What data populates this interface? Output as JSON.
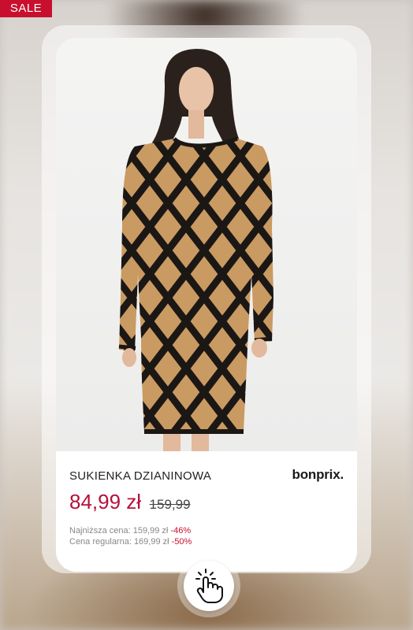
{
  "badge": {
    "label": "SALE"
  },
  "product": {
    "name": "SUKIENKA DZIANINOWA",
    "brand": "bonprix.",
    "price_current": "84,99 zł",
    "price_old": "159,99",
    "lowest_price_label": "Najniższa cena: 159,99 zł",
    "lowest_price_discount": "-46%",
    "regular_price_label": "Cena regularna: 169,99 zł",
    "regular_price_discount": "-50%",
    "image_icon": "model-in-argyle-knit-dress"
  },
  "cta": {
    "icon": "tap-hand-icon"
  },
  "colors": {
    "sale_red": "#c8102e",
    "price_red": "#b5123a",
    "dress_camel": "#c99a62",
    "dress_black": "#1b1714"
  }
}
